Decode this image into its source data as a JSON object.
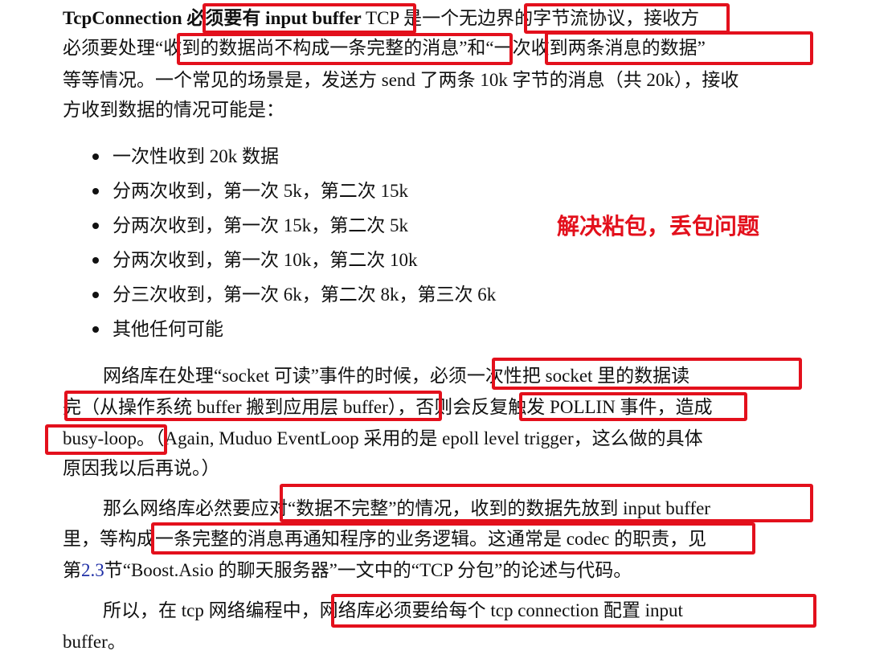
{
  "paragraph1": {
    "line1_bold": "TcpConnection 必须要有 input buffer",
    "line1_rest": " TCP 是一个无边界的字节流协议，接收方",
    "line2": "必须要处理“收到的数据尚不构成一条完整的消息”和“一次收到两条消息的数据”",
    "line3": "等等情况。一个常见的场景是，发送方 send 了两条 10k 字节的消息（共 20k），接收",
    "line4": "方收到数据的情况可能是："
  },
  "bullets": [
    "一次性收到 20k 数据",
    "分两次收到，第一次 5k，第二次 15k",
    "分两次收到，第一次 15k，第二次 5k",
    "分两次收到，第一次 10k，第二次 10k",
    "分三次收到，第一次 6k，第二次 8k，第三次 6k",
    "其他任何可能"
  ],
  "annotation": "解决粘包，丢包问题",
  "paragraph2": {
    "line1": "网络库在处理“socket 可读”事件的时候，必须一次性把 socket 里的数据读",
    "line2": "完（从操作系统 buffer 搬到应用层 buffer），否则会反复触发 POLLIN 事件，造成",
    "line3": "busy-loop。（Again, Muduo EventLoop 采用的是 epoll level trigger，这么做的具体",
    "line4": "原因我以后再说。）"
  },
  "paragraph3": {
    "line1": "那么网络库必然要应对“数据不完整”的情况，收到的数据先放到 input buffer",
    "line2": "里，等构成一条完整的消息再通知程序的业务逻辑。这通常是 codec 的职责，见",
    "line3_pre": "第",
    "line3_link": "2.3",
    "line3_post": "节“Boost.Asio 的聊天服务器”一文中的“TCP 分包”的论述与代码。"
  },
  "paragraph4": {
    "line1": "所以，在 tcp 网络编程中，网络库必须要给每个 tcp connection 配置 input",
    "line2": "buffer。"
  },
  "colors": {
    "highlight_box": "#e3101c",
    "annotation_text": "#e3101c",
    "link": "#1f2fa6",
    "text": "#111111"
  }
}
